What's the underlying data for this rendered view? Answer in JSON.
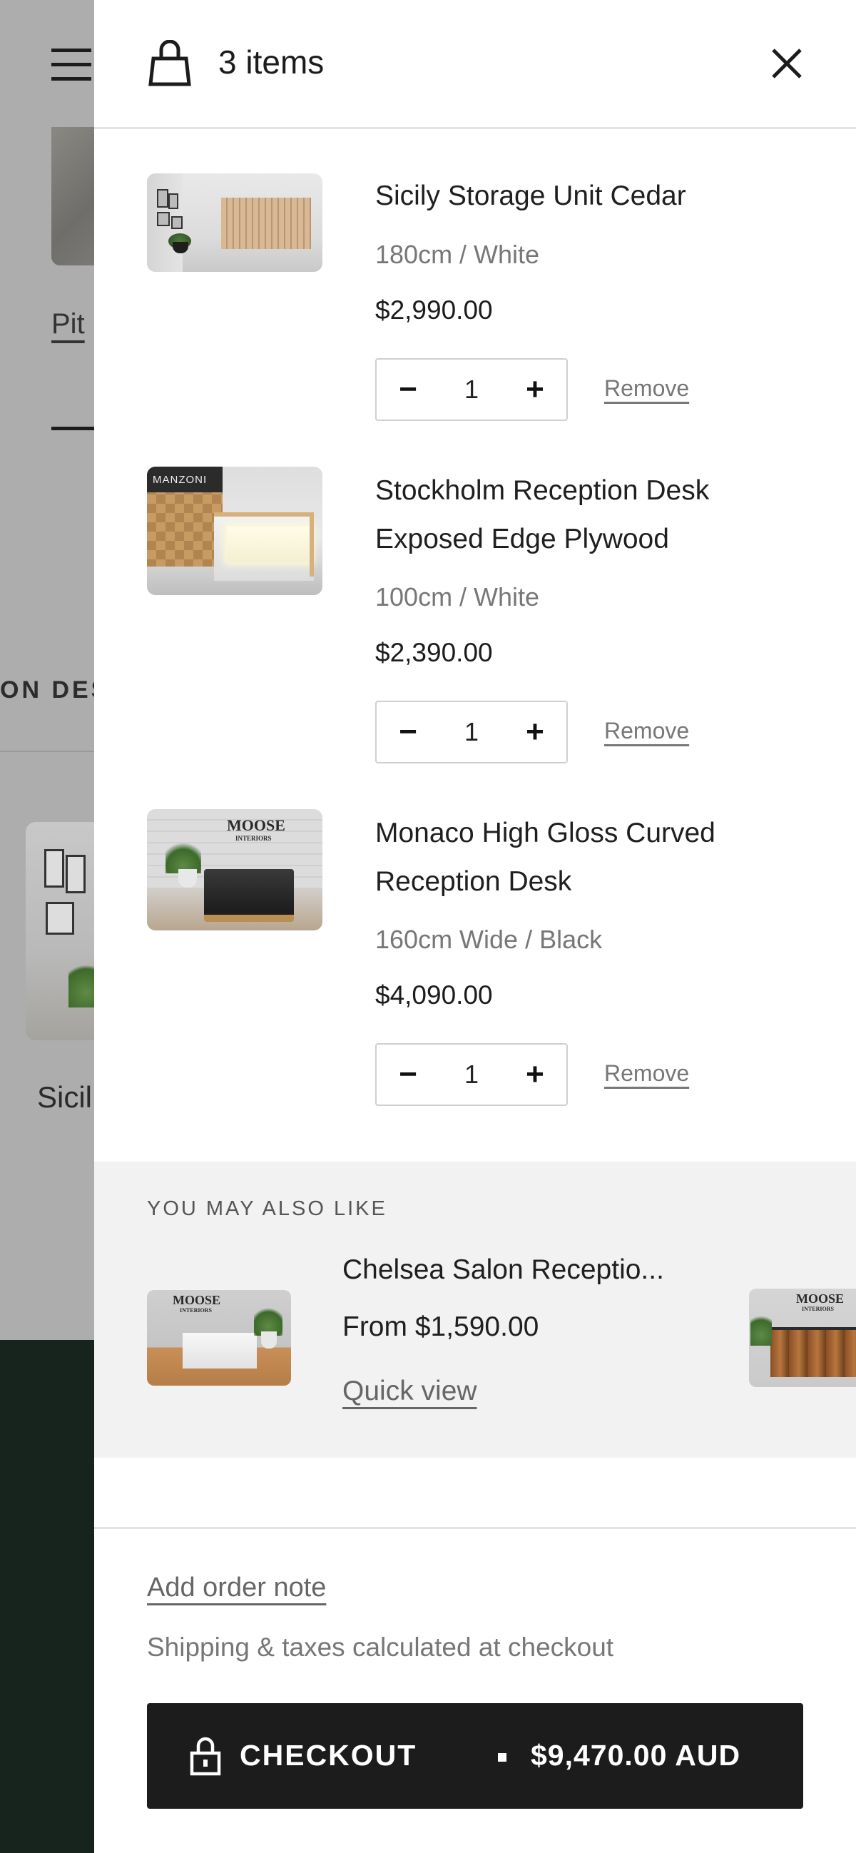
{
  "background": {
    "partial_text_1": "Pit",
    "partial_text_2": "ON DES",
    "partial_text_3": "Sicil"
  },
  "cart": {
    "count_label": "3 items",
    "items": [
      {
        "name": "Sicily Storage Unit Cedar",
        "variant": "180cm / White",
        "price": "$2,990.00",
        "quantity": "1",
        "remove_label": "Remove"
      },
      {
        "name": "Stockholm Reception Desk Exposed Edge Plywood",
        "variant": "100cm / White",
        "price": "$2,390.00",
        "quantity": "1",
        "remove_label": "Remove",
        "image_sign": "MANZONI"
      },
      {
        "name": "Monaco High Gloss Curved Reception Desk",
        "variant": "160cm Wide / Black",
        "price": "$4,090.00",
        "quantity": "1",
        "remove_label": "Remove",
        "image_logo": "MOOSE",
        "image_logo_sub": "INTERIORS"
      }
    ],
    "minus_symbol": "−",
    "plus_symbol": "+"
  },
  "upsell": {
    "heading": "YOU MAY ALSO LIKE",
    "product": {
      "name": "Chelsea Salon Receptio...",
      "price": "From $1,590.00",
      "quick_view_label": "Quick view",
      "image_logo": "MOOSE",
      "image_logo_sub": "INTERIORS"
    },
    "next_image_logo": "MOOSE",
    "next_image_logo_sub": "INTERIORS"
  },
  "footer": {
    "order_note_label": "Add order note",
    "shipping_note": "Shipping & taxes calculated at checkout",
    "checkout_label": "CHECKOUT",
    "checkout_total": "$9,470.00 AUD"
  },
  "icons": {
    "bag": "shopping-bag-icon",
    "close": "close-icon",
    "lock": "lock-icon",
    "menu": "hamburger-menu-icon"
  },
  "colors": {
    "checkout_bg": "#1c1c1c",
    "overlay": "#adadad",
    "footer_dark": "#17241e",
    "upsell_bg": "#f2f2f2"
  }
}
